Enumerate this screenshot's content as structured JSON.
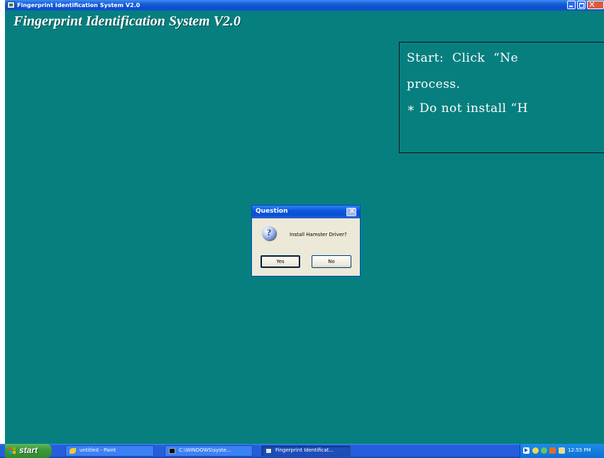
{
  "window": {
    "title": "Fingerprint Identification System V2.0",
    "heading": "Fingerprint Identification System V2.0",
    "background_color": "#077f7f"
  },
  "note": {
    "line1": "Start:  Click  “Ne",
    "line2": "process.",
    "line3": "∗ Do not install “H"
  },
  "dialog": {
    "title": "Question",
    "message": "Install Hamster Driver?",
    "icon": "question-icon",
    "yes_label": "Yes",
    "no_label": "No"
  },
  "taskbar": {
    "start_label": "start",
    "tasks": [
      {
        "label": "untitled - Paint",
        "icon": "paint-icon"
      },
      {
        "label": "C:\\WINDOWS\\syste...",
        "icon": "cmd-icon"
      },
      {
        "label": "Fingerprint Identificat...",
        "icon": "app-icon",
        "active": true
      }
    ],
    "clock": "12:55 PM"
  }
}
